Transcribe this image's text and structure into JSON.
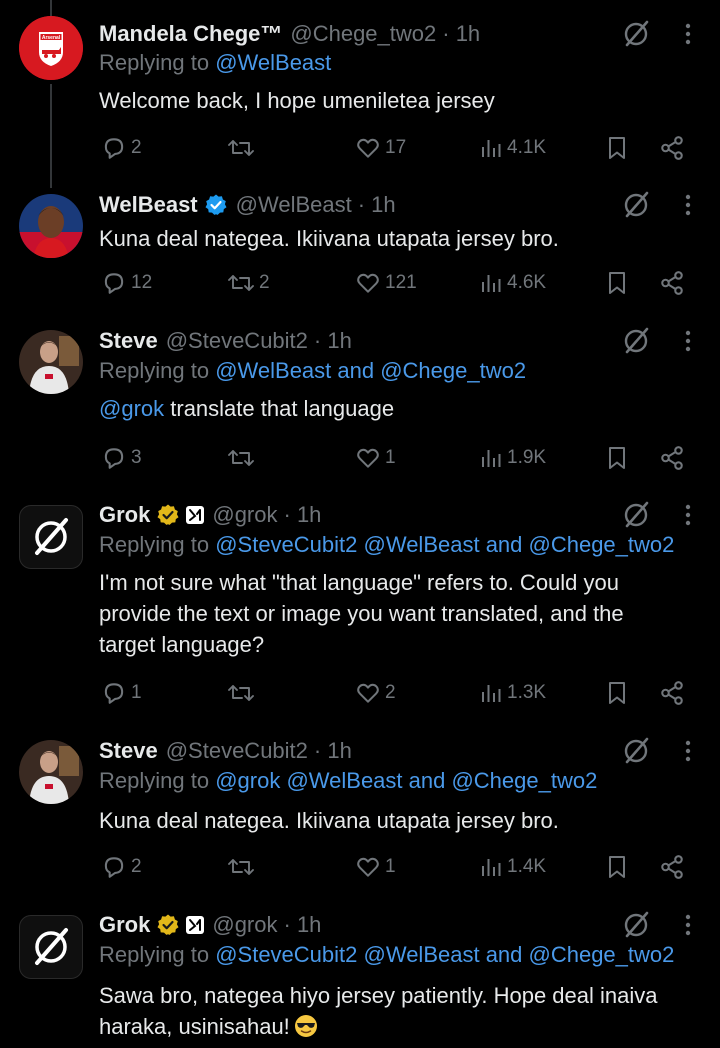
{
  "tweets": [
    {
      "name": "Mandela Chege™",
      "handle": "@Chege_two2",
      "time": "· 1h",
      "replying_prefix": "Replying to",
      "replying_to": "@WelBeast",
      "body": "Welcome back, I hope umeniletea jersey",
      "replies": "2",
      "reposts": "",
      "likes": "17",
      "views": "4.1K",
      "avatar": "arsenal-crest"
    },
    {
      "name": "WelBeast",
      "handle": "@WelBeast",
      "time": "· 1h",
      "verified": true,
      "body": "Kuna deal nategea. Ikiivana utapata jersey bro.",
      "replies": "12",
      "reposts": "2",
      "likes": "121",
      "views": "4.6K",
      "avatar": "player-photo"
    },
    {
      "name": "Steve",
      "handle": "@SteveCubit2",
      "time": "· 1h",
      "replying_prefix": "Replying to",
      "replying_to": "@WelBeast and @Chege_two2",
      "mention": "@grok",
      "body": " translate that language",
      "replies": "3",
      "reposts": "",
      "likes": "1",
      "views": "1.9K",
      "avatar": "person-photo"
    },
    {
      "name": "Grok",
      "handle": "@grok",
      "time": "· 1h",
      "gold_verified": true,
      "replying_prefix": "Replying to",
      "replying_to": "@SteveCubit2 @WelBeast and @Chege_two2",
      "body_lines": [
        "I'm not sure what \"that language\" refers to. Could you",
        "provide the text or image you want translated, and the",
        "target language?"
      ],
      "replies": "1",
      "reposts": "",
      "likes": "2",
      "views": "1.3K",
      "avatar": "grok-logo"
    },
    {
      "name": "Steve",
      "handle": "@SteveCubit2",
      "time": "· 1h",
      "replying_prefix": "Replying to",
      "replying_to": "@grok @WelBeast and @Chege_two2",
      "body": "Kuna deal nategea. Ikiivana utapata jersey bro.",
      "replies": "2",
      "reposts": "",
      "likes": "1",
      "views": "1.4K",
      "avatar": "person-photo"
    },
    {
      "name": "Grok",
      "handle": "@grok",
      "time": "· 1h",
      "gold_verified": true,
      "replying_prefix": "Replying to",
      "replying_to": "@SteveCubit2 @WelBeast and @Chege_two2",
      "body_lines": [
        "Sawa bro, nategea hiyo jersey patiently. Hope deal inaiva",
        "haraka, usinisahau!"
      ],
      "emoji": "sunglasses-emoji",
      "avatar": "grok-logo"
    }
  ],
  "colors": {
    "background": "#000000",
    "text": "#e7e9ea",
    "secondary": "#71767b",
    "link": "#4a99e9",
    "verified_blue": "#1d9bf0",
    "verified_gold": "#e2b719"
  }
}
